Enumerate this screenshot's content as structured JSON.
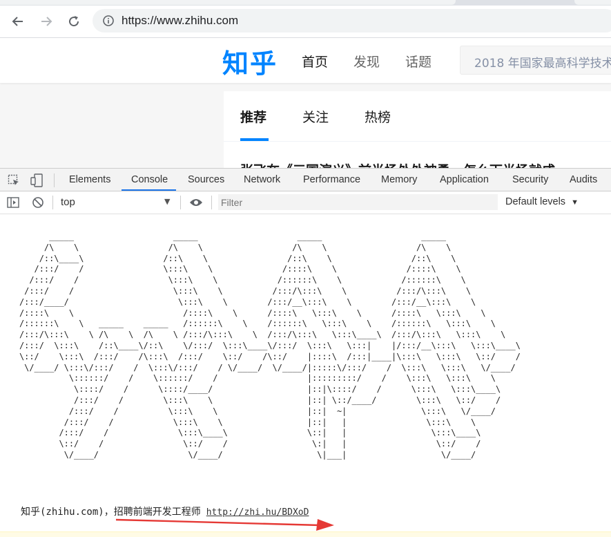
{
  "browser": {
    "url": "https://www.zhihu.com"
  },
  "zhihu": {
    "logo": "知乎",
    "nav": [
      "首页",
      "发现",
      "话题"
    ],
    "search_placeholder": "2018 年国家最高科学技术",
    "tabs": [
      "推荐",
      "关注",
      "热榜"
    ],
    "headline": "张飞在《三国演义》前半场处处神勇，怎么下半场就成"
  },
  "devtools": {
    "tabs": [
      "Elements",
      "Console",
      "Sources",
      "Network",
      "Performance",
      "Memory",
      "Application",
      "Security",
      "Audits"
    ],
    "active_tab": "Console",
    "context": "top",
    "filter_placeholder": "Filter",
    "levels": "Default levels"
  },
  "console": {
    "ascii_art": "      _____                    _____                    _____                    _____\n     /\\    \\                  /\\    \\                  /\\    \\                  /\\    \\\n    /::\\____\\                /::\\    \\                /::\\    \\                /::\\    \\\n   /:::/    /                \\:::\\    \\              /::::\\    \\              /::::\\    \\\n  /:::/    /                  \\:::\\    \\            /::::::\\    \\            /::::::\\    \\\n /:::/    /                    \\:::\\    \\          /:::/\\:::\\    \\          /:::/\\:::\\    \\\n/:::/____/                      \\:::\\    \\        /:::/__\\:::\\    \\        /:::/__\\:::\\    \\\n/::::\\    \\                      /::::\\    \\      /::::\\   \\:::\\    \\      /::::\\   \\:::\\    \\\n/::::::\\    \\   _____    _____   /::::::\\    \\    /::::::\\   \\:::\\    \\    /::::::\\   \\:::\\    \\\n/:::/\\:::\\    \\ /\\    \\  /\\    \\ /:::/\\:::\\    \\  /:::/\\:::\\   \\:::\\____\\  /:::/\\:::\\   \\:::\\    \\\n/:::/  \\:::\\    /::\\____\\/::\\    \\/:::/  \\:::\\____\\/:::/  \\:::\\   \\:::|    |/:::/__\\:::\\   \\:::\\____\\\n\\::/    \\:::\\  /:::/    /\\:::\\  /:::/    \\::/    /\\::/    |::::\\  /:::|____|\\:::\\   \\:::\\   \\::/    /\n \\/____/ \\:::\\/:::/    /  \\:::\\/:::/    / \\/____/  \\/____/|:::::\\/:::/    /  \\:::\\   \\:::\\   \\/____/\n          \\::::::/    /    \\::::::/    /                  |:::::::::/    /    \\:::\\   \\:::\\    \\\n           \\::::/    /      \\::::/____/                   |::|\\::::/    /      \\:::\\   \\:::\\____\\\n           /:::/    /        \\:::\\    \\                   |::| \\::/____/        \\:::\\   \\::/    /\n          /:::/    /          \\:::\\    \\                  |::|  ~|               \\:::\\   \\/____/\n         /:::/    /            \\:::\\    \\                 |::|   |                \\:::\\    \\\n        /:::/    /              \\:::\\____\\                \\::|   |                 \\:::\\____\\\n        \\::/    /                \\::/    /                 \\:|   |                  \\::/    /\n         \\/____/                  \\/____/                   \\|___|                   \\/____/",
    "message": "知乎(zhihu.com)，招聘前端开发工程师",
    "link": "http://zhi.hu/BDXoD",
    "annotation_color": "#e53935"
  }
}
